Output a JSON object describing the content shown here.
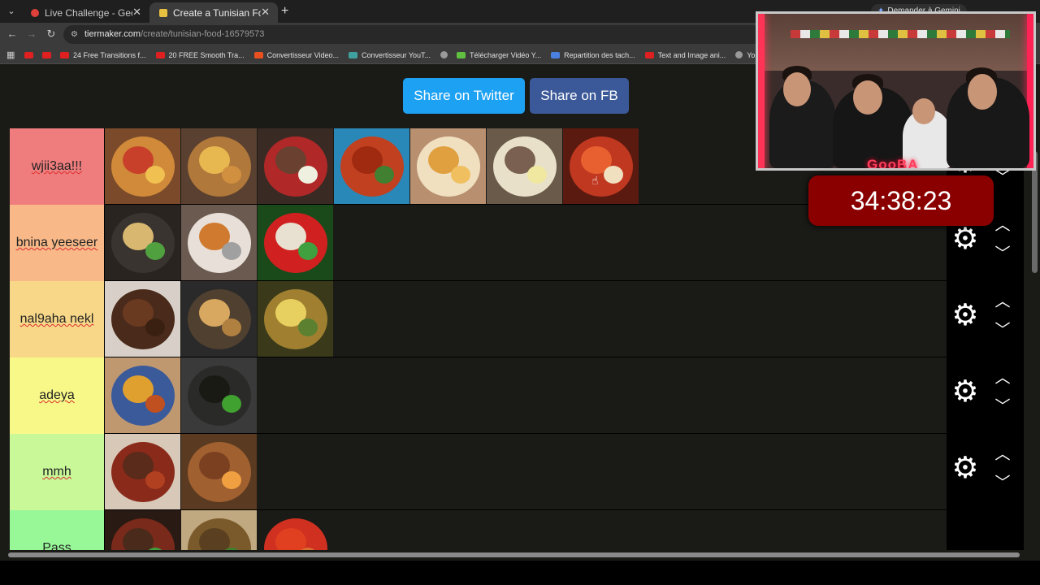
{
  "browser": {
    "tabs": [
      {
        "title": "Live Challenge - GeoGuessr",
        "active": false,
        "favicon_color": "#e0403a"
      },
      {
        "title": "Create a Tunisian Food Tier List",
        "active": true,
        "favicon_color": "#e8c040"
      }
    ],
    "gemini_label": "Demander à Gemini",
    "url_host": "tiermaker.com",
    "url_path": "/create/tunisian-food-16579573",
    "bookmarks": [
      {
        "label": "",
        "icon": "youtube-icon",
        "color": "#e02020"
      },
      {
        "label": "",
        "icon": "youtube-icon",
        "color": "#e02020"
      },
      {
        "label": "24 Free Transitions f...",
        "icon": "youtube-icon",
        "color": "#e02020"
      },
      {
        "label": "20 FREE Smooth Tra...",
        "icon": "youtube-icon",
        "color": "#e02020"
      },
      {
        "label": "Convertisseur Video...",
        "icon": "z-icon",
        "color": "#e85020"
      },
      {
        "label": "Convertisseur YouT...",
        "icon": "swap-icon",
        "color": "#40a0a0"
      },
      {
        "label": "",
        "icon": "globe-icon",
        "color": "#9a9a9a"
      },
      {
        "label": "Télécharger Vidéo Y...",
        "icon": "download-icon",
        "color": "#60c040"
      },
      {
        "label": "Repartition des tach...",
        "icon": "doc-icon",
        "color": "#4a80e0"
      },
      {
        "label": "Text and Image ani...",
        "icon": "youtube-icon",
        "color": "#e02020"
      },
      {
        "label": "YouTube Converter...",
        "icon": "globe-icon",
        "color": "#9a9a9a"
      }
    ]
  },
  "page": {
    "share_twitter": "Share on Twitter",
    "share_fb": "Share on FB",
    "tiers": [
      {
        "label": "wjii3aa!!!",
        "color": "#f07d7d",
        "items": [
          {
            "name": "pizza",
            "bg": "#7a4a2a",
            "plate": "#d08a3a",
            "a": "#c8402a",
            "b": "#f0c050"
          },
          {
            "name": "chapati-fries",
            "bg": "#5a4030",
            "plate": "#b0783a",
            "a": "#e8b850",
            "b": "#d09040"
          },
          {
            "name": "bowl-egg",
            "bg": "#3a2a24",
            "plate": "#b02828",
            "a": "#6a4030",
            "b": "#f0f0e0"
          },
          {
            "name": "spaghetti",
            "bg": "#2a88b8",
            "plate": "#c04020",
            "a": "#a02a10",
            "b": "#408030"
          },
          {
            "name": "wrap-fries",
            "bg": "#b89070",
            "plate": "#f0e0c0",
            "a": "#e0a040",
            "b": "#f0c060"
          },
          {
            "name": "salad-eggs",
            "bg": "#6a5a4a",
            "plate": "#e8e0c8",
            "a": "#7a6050",
            "b": "#f0e8a0"
          },
          {
            "name": "ojja",
            "bg": "#5a1a10",
            "plate": "#c03820",
            "a": "#e86030",
            "b": "#f0e0c0"
          }
        ]
      },
      {
        "label": "bnina yeeseer",
        "color": "#f8b888",
        "items": [
          {
            "name": "pasta-pan",
            "bg": "#2a2420",
            "plate": "#3a3430",
            "a": "#d8b870",
            "b": "#50a040"
          },
          {
            "name": "soup",
            "bg": "#6a5a50",
            "plate": "#e8e0d8",
            "a": "#d07a30",
            "b": "#a0a0a0"
          },
          {
            "name": "mechouia",
            "bg": "#1a4a1a",
            "plate": "#d02020",
            "a": "#e8e0d0",
            "b": "#40a040"
          }
        ]
      },
      {
        "label": "nal9aha nekl",
        "color": "#f8d888",
        "items": [
          {
            "name": "brochettes",
            "bg": "#d8d0c8",
            "plate": "#4a2a1a",
            "a": "#6a3a20",
            "b": "#3a2010"
          },
          {
            "name": "brik",
            "bg": "#2a2a2a",
            "plate": "#504030",
            "a": "#d8a860",
            "b": "#b08040"
          },
          {
            "name": "fries-mix",
            "bg": "#3a3a1a",
            "plate": "#a08030",
            "a": "#e8d060",
            "b": "#5a8030"
          }
        ]
      },
      {
        "label": "adeya",
        "color": "#f8f888",
        "items": [
          {
            "name": "couscous",
            "bg": "#c09870",
            "plate": "#3a5a9a",
            "a": "#e0a030",
            "b": "#c05020"
          },
          {
            "name": "mloukhia",
            "bg": "#3a3a3a",
            "plate": "#2a2a28",
            "a": "#1a1a14",
            "b": "#40a030"
          }
        ]
      },
      {
        "label": "mmh",
        "color": "#c8f898",
        "items": [
          {
            "name": "kefta-sauce",
            "bg": "#d8c8b8",
            "plate": "#8a2a1a",
            "a": "#5a2a1a",
            "b": "#b04020"
          },
          {
            "name": "roast-lamb",
            "bg": "#5a3a20",
            "plate": "#a06030",
            "a": "#7a4020",
            "b": "#f0a040"
          }
        ]
      },
      {
        "label": "Pass",
        "color": "#98f898",
        "items": [
          {
            "name": "stew",
            "bg": "#2a1a14",
            "plate": "#7a2a1a",
            "a": "#4a2a1a",
            "b": "#40a040"
          },
          {
            "name": "rice-dish",
            "bg": "#c0a880",
            "plate": "#7a5a2a",
            "a": "#5a4020",
            "b": "#408030"
          },
          {
            "name": "peppers",
            "bg": "#1a1a17",
            "plate": "#d03020",
            "a": "#e04020",
            "b": "#d87030"
          }
        ]
      }
    ]
  },
  "overlay": {
    "channel_logo": "GooBA",
    "timer": "34:38:23"
  }
}
